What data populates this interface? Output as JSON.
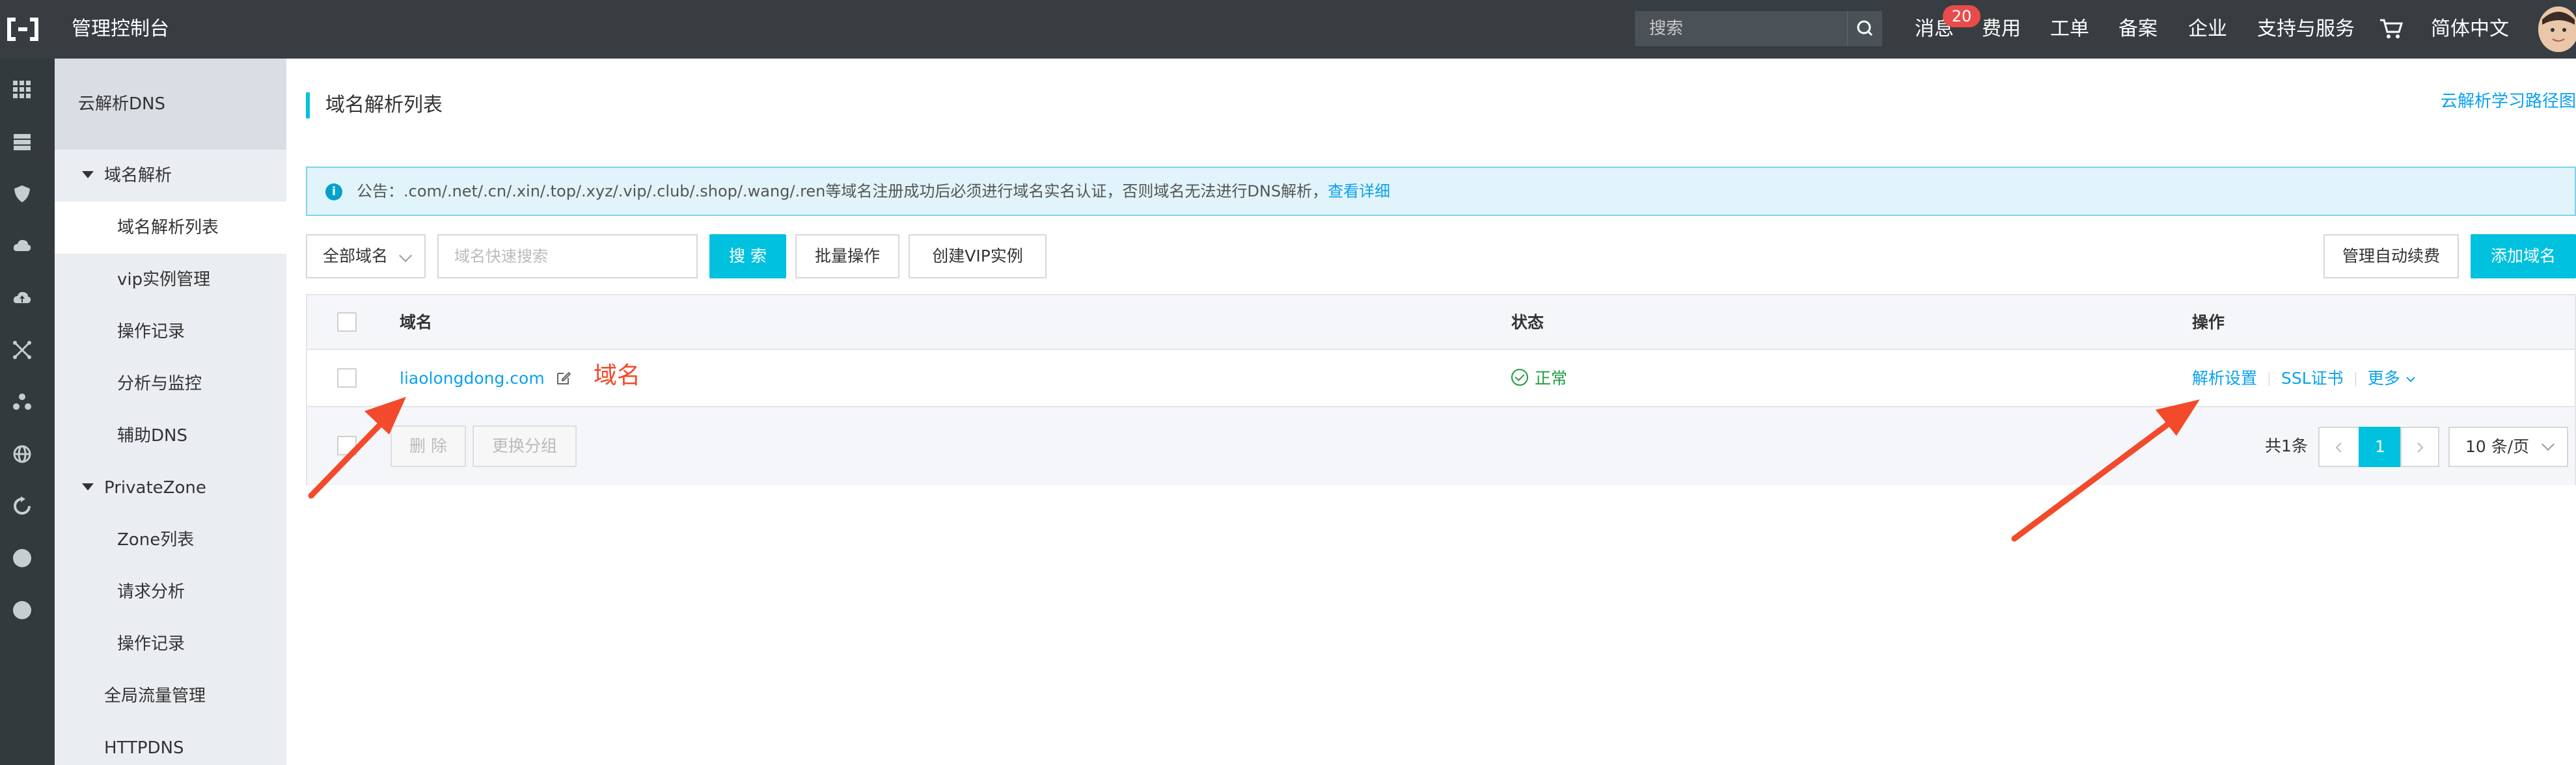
{
  "topbar": {
    "title": "管理控制台",
    "search_placeholder": "搜索",
    "messages_label": "消息",
    "messages_badge": "20",
    "fees_label": "费用",
    "tickets_label": "工单",
    "filing_label": "备案",
    "enterprise_label": "企业",
    "support_label": "支持与服务",
    "language_label": "简体中文",
    "accent_color": "#00c1de"
  },
  "rail": {
    "icons": [
      "grid-icon",
      "server-icon",
      "shield-icon",
      "cloud-icon",
      "upload-cloud-icon",
      "network-icon",
      "cluster-icon",
      "globe-icon",
      "refresh-icon",
      "circle-icon",
      "circle-icon"
    ]
  },
  "sidebar": {
    "header": "云解析DNS",
    "items": [
      {
        "label": "域名解析",
        "group": true
      },
      {
        "label": "域名解析列表",
        "active": true
      },
      {
        "label": "vip实例管理"
      },
      {
        "label": "操作记录"
      },
      {
        "label": "分析与监控"
      },
      {
        "label": "辅助DNS"
      },
      {
        "label": "PrivateZone",
        "group": true
      },
      {
        "label": "Zone列表"
      },
      {
        "label": "请求分析"
      },
      {
        "label": "操作记录"
      },
      {
        "label": "全局流量管理"
      },
      {
        "label": "HTTPDNS"
      }
    ]
  },
  "main": {
    "page_title": "域名解析列表",
    "learning_path_link": "云解析学习路径图",
    "notice": {
      "text": "公告：.com/.net/.cn/.xin/.top/.xyz/.vip/.club/.shop/.wang/.ren等域名注册成功后必须进行域名实名认证，否则域名无法进行DNS解析，",
      "link": "查看详细"
    },
    "toolbar": {
      "domain_filter": "全部域名",
      "search_placeholder": "域名快速搜索",
      "search_button": "搜 索",
      "batch_button": "批量操作",
      "create_vip_button": "创建VIP实例",
      "auto_renew_button": "管理自动续费",
      "add_domain_button": "添加域名"
    },
    "table": {
      "headers": {
        "domain": "域名",
        "status": "状态",
        "actions": "操作"
      },
      "rows": [
        {
          "domain": "liaolongdong.com",
          "status": "正常",
          "actions": {
            "dns_settings": "解析设置",
            "ssl": "SSL证书",
            "more": "更多"
          }
        }
      ],
      "footer": {
        "delete_button": "删 除",
        "change_group_button": "更换分组",
        "total": "共1条",
        "current_page": "1",
        "page_size": "10 条/页"
      }
    },
    "annotation": {
      "label": "域名",
      "color": "#f24a2a"
    }
  }
}
